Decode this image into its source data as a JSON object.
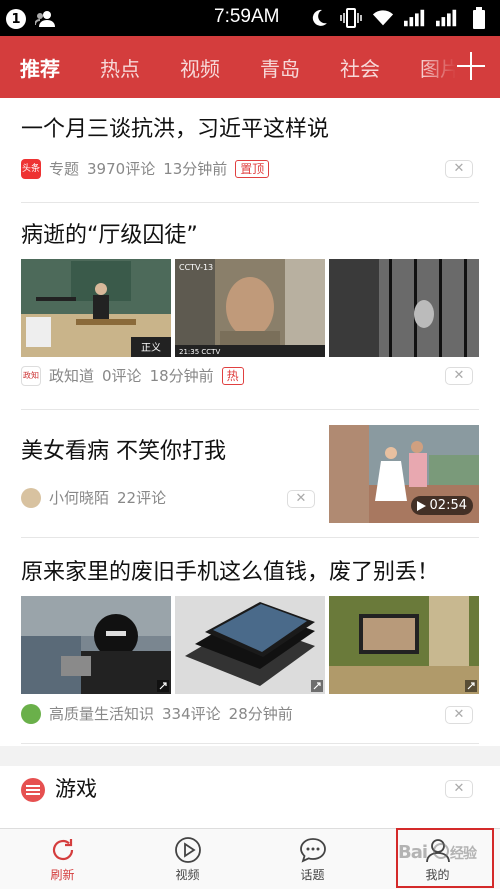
{
  "status_bar": {
    "notification_count": "1",
    "time": "7:59AM"
  },
  "header": {
    "tabs": [
      "推荐",
      "热点",
      "视频",
      "青岛",
      "社会",
      "图片"
    ],
    "active_tab": 0,
    "accent_color": "#d43d3d"
  },
  "feed": [
    {
      "title": "一个月三谈抗洪，习近平这样说",
      "source_icon_text": "头条",
      "source": "专题",
      "comments": "3970评论",
      "time": "13分钟前",
      "tag": "置顶"
    },
    {
      "title": "病逝的“厅级囚徒”",
      "source_icon_text": "政知",
      "source": "政知道",
      "comments": "0评论",
      "time": "18分钟前",
      "tag": "热"
    },
    {
      "title": "美女看病 不笑你打我",
      "source": "小何晓陌",
      "comments": "22评论",
      "duration": "02:54"
    },
    {
      "title": "原来家里的废旧手机这么值钱，废了别丢！",
      "source": "高质量生活知识",
      "comments": "334评论",
      "time": "28分钟前"
    }
  ],
  "game_section": {
    "title": "游戏"
  },
  "dismiss_label": "✕",
  "bottom_nav": [
    {
      "label": "刷新",
      "icon": "refresh-icon",
      "active": true
    },
    {
      "label": "视频",
      "icon": "play-icon",
      "active": false
    },
    {
      "label": "话题",
      "icon": "chat-icon",
      "active": false
    },
    {
      "label": "我的",
      "icon": "user-icon",
      "active": false
    }
  ]
}
